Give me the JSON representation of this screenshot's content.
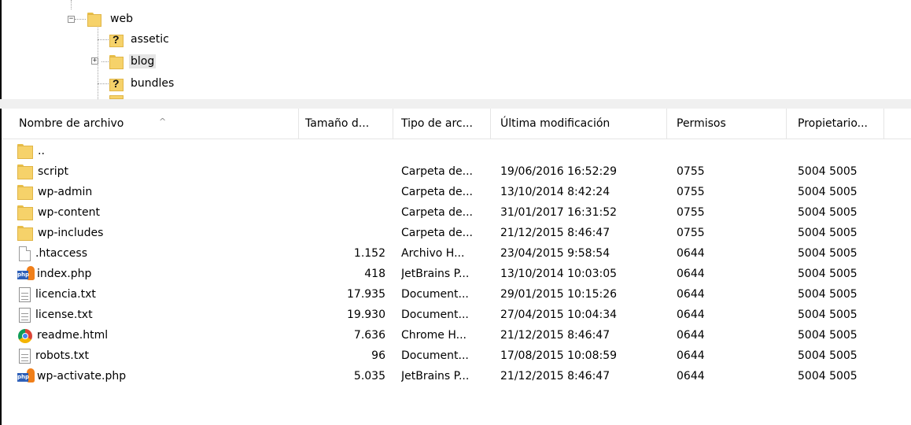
{
  "tree": {
    "nodes": [
      {
        "label": "web",
        "expander": "−",
        "icon": "folder-icon"
      },
      {
        "label": "assetic",
        "icon": "unknown-folder-icon",
        "icon_glyph": "?"
      },
      {
        "label": "blog",
        "expander": "+",
        "icon": "folder-icon"
      },
      {
        "label": "bundles",
        "icon": "unknown-folder-icon",
        "icon_glyph": "?"
      }
    ]
  },
  "list": {
    "columns": {
      "name": "Nombre de archivo",
      "size": "Tamaño d...",
      "type": "Tipo de arc...",
      "modified": "Última modificación",
      "permissions": "Permisos",
      "owner": "Propietario..."
    },
    "sort_indicator": "^",
    "rows": [
      {
        "icon": "folder-icon",
        "name": "..",
        "size": "",
        "type": "",
        "modified": "",
        "permissions": "",
        "owner": ""
      },
      {
        "icon": "folder-icon",
        "name": "script",
        "size": "",
        "type": "Carpeta de...",
        "modified": "19/06/2016 16:52:29",
        "permissions": "0755",
        "owner": "5004 5005"
      },
      {
        "icon": "folder-icon",
        "name": "wp-admin",
        "size": "",
        "type": "Carpeta de...",
        "modified": "13/10/2014 8:42:24",
        "permissions": "0755",
        "owner": "5004 5005"
      },
      {
        "icon": "folder-icon",
        "name": "wp-content",
        "size": "",
        "type": "Carpeta de...",
        "modified": "31/01/2017 16:31:52",
        "permissions": "0755",
        "owner": "5004 5005"
      },
      {
        "icon": "folder-icon",
        "name": "wp-includes",
        "size": "",
        "type": "Carpeta de...",
        "modified": "21/12/2015 8:46:47",
        "permissions": "0755",
        "owner": "5004 5005"
      },
      {
        "icon": "blank-file-icon",
        "name": ".htaccess",
        "size": "1.152",
        "type": "Archivo H...",
        "modified": "23/04/2015 9:58:54",
        "permissions": "0644",
        "owner": "5004 5005"
      },
      {
        "icon": "php-file-icon",
        "icon_glyph": "php",
        "name": "index.php",
        "size": "418",
        "type": "JetBrains P...",
        "modified": "13/10/2014 10:03:05",
        "permissions": "0644",
        "owner": "5004 5005"
      },
      {
        "icon": "text-file-icon",
        "name": "licencia.txt",
        "size": "17.935",
        "type": "Document...",
        "modified": "29/01/2015 10:15:26",
        "permissions": "0644",
        "owner": "5004 5005"
      },
      {
        "icon": "text-file-icon",
        "name": "license.txt",
        "size": "19.930",
        "type": "Document...",
        "modified": "27/04/2015 10:04:34",
        "permissions": "0644",
        "owner": "5004 5005"
      },
      {
        "icon": "chrome-icon",
        "name": "readme.html",
        "size": "7.636",
        "type": "Chrome H...",
        "modified": "21/12/2015 8:46:47",
        "permissions": "0644",
        "owner": "5004 5005"
      },
      {
        "icon": "text-file-icon",
        "name": "robots.txt",
        "size": "96",
        "type": "Document...",
        "modified": "17/08/2015 10:08:59",
        "permissions": "0644",
        "owner": "5004 5005"
      },
      {
        "icon": "php-file-icon",
        "icon_glyph": "php",
        "name": "wp-activate.php",
        "size": "5.035",
        "type": "JetBrains P...",
        "modified": "21/12/2015 8:46:47",
        "permissions": "0644",
        "owner": "5004 5005"
      }
    ]
  },
  "colors": {
    "folder": "#f6d26a",
    "folder_border": "#e0b547",
    "selected_bg": "#e5e5e5",
    "php_blue": "#2d5fb8",
    "php_orange": "#f07f1a"
  }
}
